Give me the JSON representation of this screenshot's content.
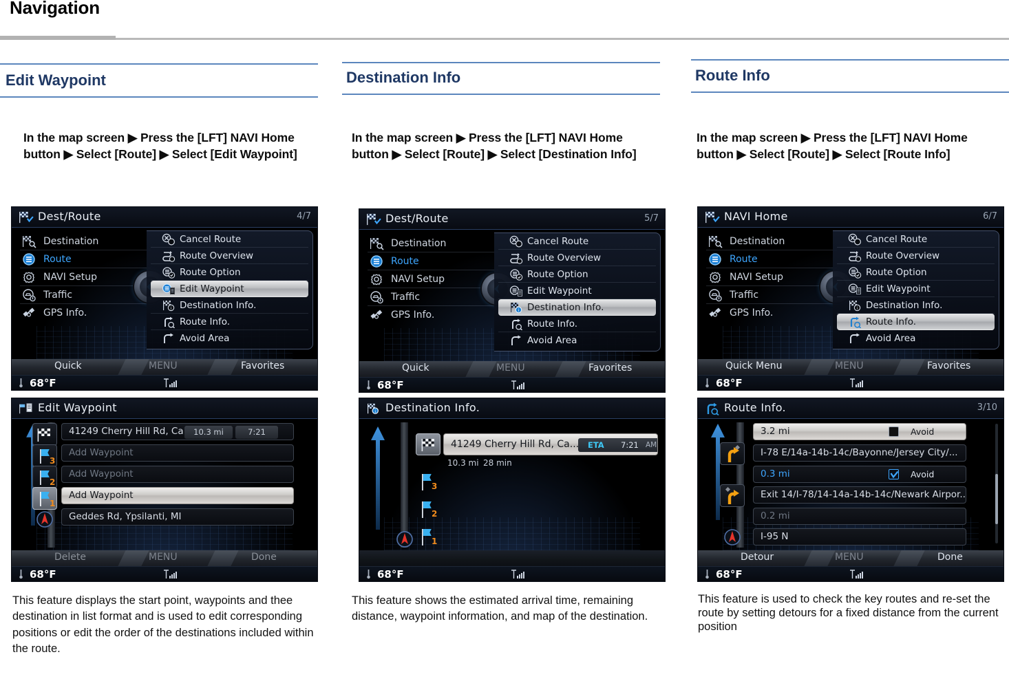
{
  "document": {
    "title": "Navigation"
  },
  "columns": [
    {
      "id": "edit-waypoint",
      "section_title": "Edit Waypoint",
      "instruction": "In the map screen ▶ Press the [LFT] NAVI Home button ▶ Select [Route] ▶ Select [Edit Waypoint]",
      "description": "This feature displays the start point, waypoints and thee destination in list format and is used to edit corresponding positions or edit the order of the destinations included within the route.",
      "screens": [
        {
          "type": "menu",
          "title": "Dest/Route",
          "page_indicator": "4/7",
          "left_menu": [
            {
              "label": "Destination",
              "icon": "destination-flag-icon",
              "active": false
            },
            {
              "label": "Route",
              "icon": "route-icon",
              "active": true
            },
            {
              "label": "NAVI Setup",
              "icon": "gear-icon",
              "active": false
            },
            {
              "label": "Traffic",
              "icon": "traffic-icon",
              "active": false
            },
            {
              "label": "GPS Info.",
              "icon": "satellite-icon",
              "active": false
            }
          ],
          "right_menu": [
            {
              "label": "Cancel Route",
              "icon": "cancel-route-icon",
              "selected": false
            },
            {
              "label": "Route Overview",
              "icon": "route-overview-icon",
              "selected": false
            },
            {
              "label": "Route Option",
              "icon": "route-option-icon",
              "selected": false
            },
            {
              "label": "Edit Waypoint",
              "icon": "edit-waypoint-icon",
              "selected": true
            },
            {
              "label": "Destination Info.",
              "icon": "destination-info-icon",
              "selected": false
            },
            {
              "label": "Route Info.",
              "icon": "route-info-icon",
              "selected": false
            },
            {
              "label": "Avoid Area",
              "icon": "avoid-area-icon",
              "selected": false
            }
          ],
          "tabs": {
            "left": "Quick",
            "center": "MENU",
            "right": "Favorites"
          },
          "status": {
            "temperature": "68°F",
            "signal": "signal-bars-icon"
          }
        },
        {
          "type": "waypoint-list",
          "title": "Edit Waypoint",
          "page_indicator": "",
          "rows": [
            {
              "label": "41249 Cherry Hill Rd, Ca...",
              "badge": "checkered-flag-icon",
              "distance": "10.3 mi",
              "time": "7:21",
              "selected": false,
              "dim": false
            },
            {
              "label": "Add Waypoint",
              "badge": "waypoint-flag-3-icon",
              "selected": false,
              "dim": true
            },
            {
              "label": "Add Waypoint",
              "badge": "waypoint-flag-2-icon",
              "selected": false,
              "dim": true
            },
            {
              "label": "Add Waypoint",
              "badge": "waypoint-flag-1-icon",
              "selected": true,
              "dim": false
            },
            {
              "label": "Geddes Rd, Ypsilanti, MI",
              "badge": "current-position-icon",
              "selected": false,
              "dim": false
            }
          ],
          "tabs": {
            "left": "Delete",
            "center": "MENU",
            "right": "Done"
          },
          "status": {
            "temperature": "68°F",
            "signal": "signal-bars-icon"
          }
        }
      ]
    },
    {
      "id": "destination-info",
      "section_title": "Destination Info",
      "instruction": "In the map screen ▶ Press the [LFT] NAVI Home button ▶ Select [Route] ▶ Select [Destination Info]",
      "description": "This feature shows the estimated arrival time, remaining distance, waypoint information, and map of the destination.",
      "screens": [
        {
          "type": "menu",
          "title": "Dest/Route",
          "page_indicator": "5/7",
          "left_menu": [
            {
              "label": "Destination",
              "icon": "destination-flag-icon",
              "active": false
            },
            {
              "label": "Route",
              "icon": "route-icon",
              "active": true
            },
            {
              "label": "NAVI Setup",
              "icon": "gear-icon",
              "active": false
            },
            {
              "label": "Traffic",
              "icon": "traffic-icon",
              "active": false
            },
            {
              "label": "GPS Info.",
              "icon": "satellite-icon",
              "active": false
            }
          ],
          "right_menu": [
            {
              "label": "Cancel Route",
              "icon": "cancel-route-icon",
              "selected": false
            },
            {
              "label": "Route Overview",
              "icon": "route-overview-icon",
              "selected": false
            },
            {
              "label": "Route Option",
              "icon": "route-option-icon",
              "selected": false
            },
            {
              "label": "Edit Waypoint",
              "icon": "edit-waypoint-icon",
              "selected": false
            },
            {
              "label": "Destination Info.",
              "icon": "destination-info-icon",
              "selected": true
            },
            {
              "label": "Route Info.",
              "icon": "route-info-icon",
              "selected": false
            },
            {
              "label": "Avoid Area",
              "icon": "avoid-area-icon",
              "selected": false
            }
          ],
          "tabs": {
            "left": "Quick",
            "center": "MENU",
            "right": "Favorites"
          },
          "status": {
            "temperature": "68°F",
            "signal": "signal-bars-icon"
          }
        },
        {
          "type": "destination-info",
          "title": "Destination Info.",
          "page_indicator": "",
          "destination": {
            "address": "41249 Cherry Hill Rd, Ca...",
            "eta_label": "ETA",
            "eta_time": "7:21",
            "eta_meridiem": "AM",
            "distance": "10.3 mi",
            "duration": "28 min",
            "badge": "checkered-flag-icon"
          },
          "waypoints": [
            {
              "badge": "waypoint-flag-3-icon"
            },
            {
              "badge": "waypoint-flag-2-icon"
            },
            {
              "badge": "waypoint-flag-1-icon"
            }
          ],
          "status": {
            "temperature": "68°F",
            "signal": "signal-bars-icon"
          }
        }
      ]
    },
    {
      "id": "route-info",
      "section_title": "Route Info",
      "instruction": "In the map screen ▶ Press the [LFT] NAVI Home button ▶ Select [Route] ▶ Select [Route Info]",
      "description": "This feature is used to check the key routes and re-set the route by setting detours for a fixed distance from the current position",
      "screens": [
        {
          "type": "menu",
          "title": "NAVI Home",
          "page_indicator": "6/7",
          "left_menu": [
            {
              "label": "Destination",
              "icon": "destination-flag-icon",
              "active": false
            },
            {
              "label": "Route",
              "icon": "route-icon",
              "active": true
            },
            {
              "label": "NAVI Setup",
              "icon": "gear-icon",
              "active": false
            },
            {
              "label": "Traffic",
              "icon": "traffic-icon",
              "active": false
            },
            {
              "label": "GPS Info.",
              "icon": "satellite-icon",
              "active": false
            }
          ],
          "right_menu": [
            {
              "label": "Cancel Route",
              "icon": "cancel-route-icon",
              "selected": false
            },
            {
              "label": "Route Overview",
              "icon": "route-overview-icon",
              "selected": false
            },
            {
              "label": "Route Option",
              "icon": "route-option-icon",
              "selected": false
            },
            {
              "label": "Edit Waypoint",
              "icon": "edit-waypoint-icon",
              "selected": false
            },
            {
              "label": "Destination Info.",
              "icon": "destination-info-icon",
              "selected": false
            },
            {
              "label": "Route Info.",
              "icon": "route-info-icon",
              "selected": true
            },
            {
              "label": "Avoid Area",
              "icon": "avoid-area-icon",
              "selected": false
            }
          ],
          "tabs": {
            "left": "Quick Menu",
            "center": "MENU",
            "right": "Favorites"
          },
          "status": {
            "temperature": "68°F",
            "signal": "signal-bars-icon"
          }
        },
        {
          "type": "route-list",
          "title": "Route Info.",
          "page_indicator": "3/10",
          "rows": [
            {
              "kind": "distance",
              "label": "3.2 mi",
              "avoid_label": "Avoid",
              "checked": false,
              "selected": true,
              "dim": false,
              "blue": false
            },
            {
              "kind": "maneuver",
              "label": "I-78 E/14a-14b-14c/Bayonne/Jersey City/...",
              "badge": "turn-right-icon",
              "selected": false,
              "dim": false,
              "blue": false
            },
            {
              "kind": "distance",
              "label": "0.3 mi",
              "avoid_label": "Avoid",
              "checked": true,
              "selected": false,
              "dim": false,
              "blue": true
            },
            {
              "kind": "maneuver",
              "label": "Exit 14/I-78/14-14a-14b-14c/Newark Airpor...",
              "badge": "exit-right-icon",
              "selected": false,
              "dim": false,
              "blue": false
            },
            {
              "kind": "distance",
              "label": "0.2 mi",
              "selected": false,
              "dim": true,
              "blue": false
            },
            {
              "kind": "maneuver",
              "label": "I-95 N",
              "badge": "current-position-icon",
              "selected": false,
              "dim": false,
              "blue": false
            }
          ],
          "tabs": {
            "left": "Detour",
            "center": "MENU",
            "right": "Done"
          },
          "status": {
            "temperature": "68°F",
            "signal": "signal-bars-icon"
          }
        }
      ]
    }
  ]
}
